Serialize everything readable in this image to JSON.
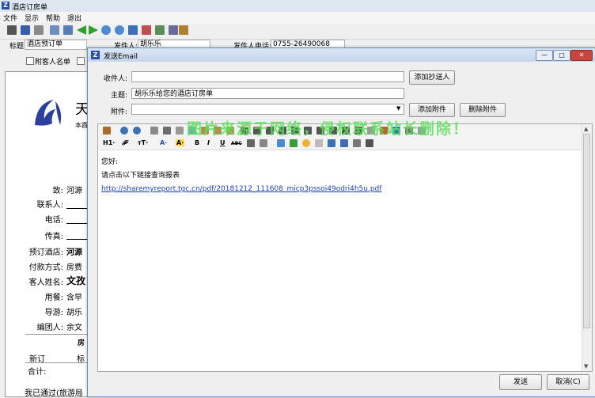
{
  "window": {
    "title": "酒店订房单"
  },
  "menu": [
    "文件",
    "显示",
    "帮助",
    "退出"
  ],
  "header": {
    "title_label": "标题:",
    "title_value": "酒店预订单",
    "sender_label": "发件人:",
    "sender_value": "胡乐乐",
    "sender_phone_label": "发件人电话:",
    "sender_phone_value": "0755-26490068"
  },
  "checkbox": {
    "label": "附客人名单"
  },
  "document": {
    "logo_text": "天",
    "small_text": "本酉",
    "labels": [
      "致:",
      "联系人:",
      "电话:",
      "传真:",
      "预订酒店:",
      "付款方式:",
      "客人姓名:",
      "用餐:",
      "导游:",
      "编团人:"
    ],
    "values": [
      "河源",
      "",
      "",
      "",
      "河源",
      "房费",
      "文孜",
      "含早",
      "胡乐",
      "余文"
    ],
    "table_header": "房",
    "row_new": "新订",
    "row_new_val": "标",
    "row_total": "合计:",
    "footer": "我已通过(旅游局"
  },
  "dialog": {
    "title": "发送Email",
    "recipient_label": "收件人:",
    "recipient_value": "",
    "subject_label": "主题:",
    "subject_value": "胡乐乐给您的酒店订房单",
    "attachment_label": "附件:",
    "attachment_value": "",
    "add_cc_button": "添加抄送人",
    "add_attachment_button": "添加附件",
    "delete_attachment_button": "删除附件",
    "send_button": "发送",
    "cancel_button": "取消(C)"
  },
  "editor": {
    "toolbar2_labels": {
      "heading": "H1·",
      "font": "𝓕·",
      "size": "тT·",
      "color": "A·",
      "bold": "B",
      "italic": "I",
      "underline": "U",
      "strike": "ABC"
    },
    "greeting": "您好:",
    "instruction": "请点击以下链接查询报表",
    "link": "http://sharemyreport.tgc.cn/pdf/20181212_111608_micp3pssoi49odri4h5u.pdf"
  },
  "watermark": "图片来源于网络，侵权联系站长删除！",
  "colors": {
    "accent": "#2b4fa8",
    "link": "#1a3fbf",
    "watermark": "#5fe15f"
  }
}
